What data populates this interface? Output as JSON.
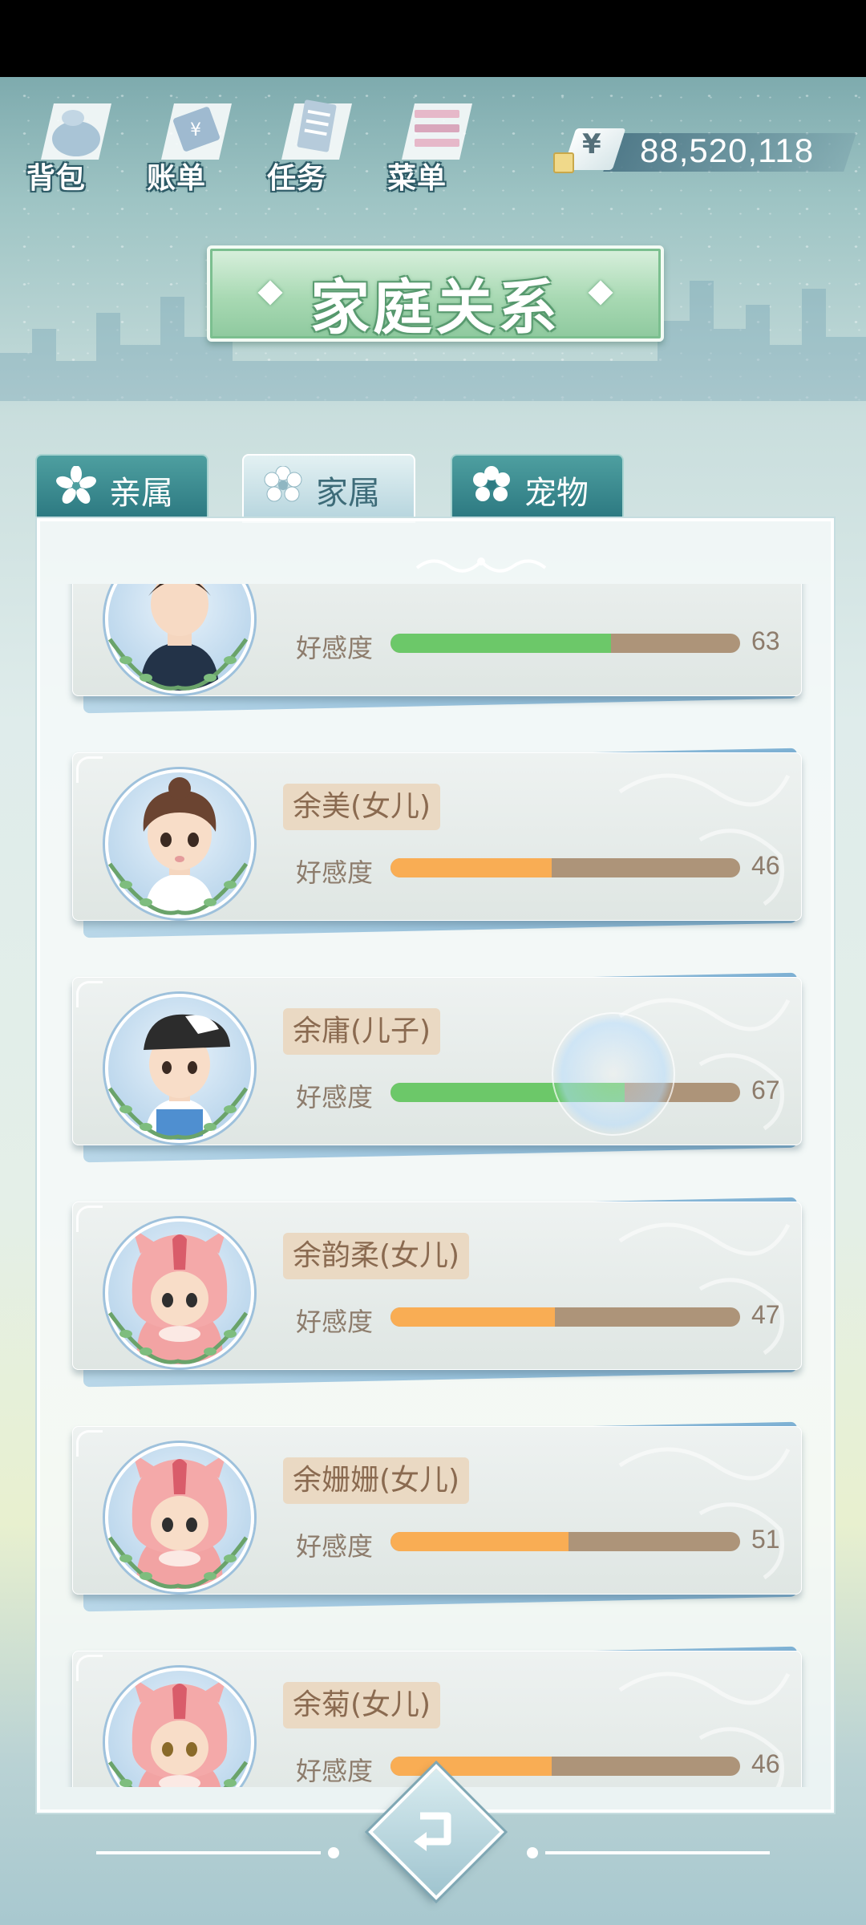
{
  "top_nav": [
    {
      "label": "背包",
      "icon": "bag-icon"
    },
    {
      "label": "账单",
      "icon": "bill-icon"
    },
    {
      "label": "任务",
      "icon": "task-icon"
    },
    {
      "label": "菜单",
      "icon": "menu-icon"
    }
  ],
  "currency": {
    "symbol": "¥",
    "value": "88,520,118"
  },
  "title": "家庭关系",
  "tabs": [
    {
      "label": "亲属",
      "active": false
    },
    {
      "label": "家属",
      "active": true
    },
    {
      "label": "宠物",
      "active": false
    }
  ],
  "affection_label": "好感度",
  "members": [
    {
      "name": "",
      "affection": 63,
      "bar_color": "green",
      "avatar": "dark-hair-boy"
    },
    {
      "name": "余美(女儿)",
      "affection": 46,
      "bar_color": "orange",
      "avatar": "brown-hair-girl"
    },
    {
      "name": "余庸(儿子)",
      "affection": 67,
      "bar_color": "green",
      "avatar": "cap-boy"
    },
    {
      "name": "余韵柔(女儿)",
      "affection": 47,
      "bar_color": "orange",
      "avatar": "pink-hood-baby"
    },
    {
      "name": "余姗姗(女儿)",
      "affection": 51,
      "bar_color": "orange",
      "avatar": "pink-hood-baby"
    },
    {
      "name": "余菊(女儿)",
      "affection": 46,
      "bar_color": "orange",
      "avatar": "pink-hood-baby"
    }
  ],
  "colors": {
    "bar_green": "#6cc869",
    "bar_orange": "#f9ad54",
    "bar_track": "#ad9479",
    "title_green": "#a8d9b3",
    "tab_teal": "#2d7a82"
  }
}
